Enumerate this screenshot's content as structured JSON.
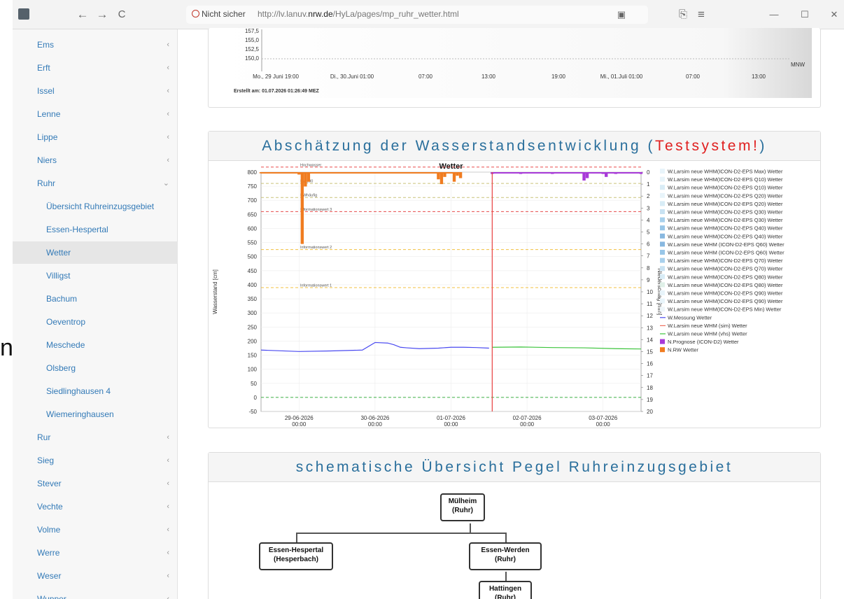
{
  "window": {
    "back": "←",
    "forward": "→",
    "reload": "C",
    "reader": "▣",
    "share": "⎘",
    "menu": "≡",
    "minimize": "—",
    "maximize": "☐",
    "close": "✕"
  },
  "address": {
    "insecure_label": "Nicht sicher",
    "url_prefix": "http://lv.lanuv.",
    "url_domain": "nrw.de",
    "url_suffix": "/HyLa/pages/mp_ruhr_wetter.html"
  },
  "bg_glyph": "n",
  "sidebar": {
    "items": [
      {
        "label": "Ems",
        "chevron": "‹"
      },
      {
        "label": "Erft",
        "chevron": "‹"
      },
      {
        "label": "Issel",
        "chevron": "‹"
      },
      {
        "label": "Lenne",
        "chevron": "‹"
      },
      {
        "label": "Lippe",
        "chevron": "‹"
      },
      {
        "label": "Niers",
        "chevron": "‹"
      },
      {
        "label": "Ruhr",
        "chevron": "⌄"
      },
      {
        "label": "Übersicht Ruhreinzugsgebiet"
      },
      {
        "label": "Essen-Hespertal"
      },
      {
        "label": "Wetter"
      },
      {
        "label": "Villigst"
      },
      {
        "label": "Bachum"
      },
      {
        "label": "Oeventrop"
      },
      {
        "label": "Meschede"
      },
      {
        "label": "Olsberg"
      },
      {
        "label": "Siedlinghausen 4"
      },
      {
        "label": "Wiemeringhausen"
      },
      {
        "label": "Rur",
        "chevron": "‹"
      },
      {
        "label": "Sieg",
        "chevron": "‹"
      },
      {
        "label": "Stever",
        "chevron": "‹"
      },
      {
        "label": "Vechte",
        "chevron": "‹"
      },
      {
        "label": "Volme",
        "chevron": "‹"
      },
      {
        "label": "Werre",
        "chevron": "‹"
      },
      {
        "label": "Weser",
        "chevron": "‹"
      },
      {
        "label": "Wupper",
        "chevron": "‹"
      }
    ]
  },
  "top_chart": {
    "y_ticks": [
      "157,5",
      "155,0",
      "152,5",
      "150,0"
    ],
    "x_ticks": [
      "Mo., 29 Juni 19:00",
      "Di., 30.Juni 01:00",
      "07:00",
      "13:00",
      "19:00",
      "Mi., 01.Juli 01:00",
      "07:00",
      "13:00"
    ],
    "mnw_label": "MNW",
    "created": "Erstellt am: 01.07.2026 01:26:49 MEZ"
  },
  "panel1": {
    "title_prefix": "Abschätzung der Wasserstandsentwicklung (",
    "title_red": "Testsystem!",
    "title_suffix": ")"
  },
  "chart_data": {
    "type": "line",
    "title": "Wetter",
    "ylabel": "Wasserstand [cm]",
    "y2label": "Niederschlag [mm]",
    "ylim": [
      -50,
      800
    ],
    "y2lim": [
      0,
      20
    ],
    "y_ticks": [
      800,
      750,
      700,
      650,
      600,
      550,
      500,
      450,
      400,
      350,
      300,
      250,
      200,
      150,
      100,
      50,
      0,
      -50
    ],
    "y2_ticks": [
      0,
      1,
      2,
      3,
      4,
      5,
      6,
      7,
      8,
      9,
      10,
      11,
      12,
      13,
      14,
      15,
      16,
      17,
      18,
      19,
      20
    ],
    "x_ticks": [
      "29-06-2026\n00:00",
      "30-06-2026\n00:00",
      "01-07-2026\n00:00",
      "02-07-2026\n00:00",
      "03-07-2026\n00:00"
    ],
    "x_range_hours": [
      -12,
      108
    ],
    "now_marker_hour": 61,
    "thresholds": [
      {
        "label": "Hochwasser",
        "value": 818,
        "color": "#e84c4c"
      },
      {
        "label": "HW100",
        "value": 760,
        "color": "#c9c27a"
      },
      {
        "label": "HWhäufig",
        "value": 710,
        "color": "#c9c27a"
      },
      {
        "label": "Informationswert 3",
        "value": 660,
        "color": "#e84c4c"
      },
      {
        "label": "Informationswert 2",
        "value": 525,
        "color": "#f0c040"
      },
      {
        "label": "Informationswert 1",
        "value": 390,
        "color": "#f0c040"
      },
      {
        "label": "",
        "value": 0,
        "color": "#3cb043"
      }
    ],
    "series": [
      {
        "name": "W.Messung Wetter",
        "color": "#4a4af0",
        "x": [
          -12,
          0,
          10,
          20,
          24,
          28,
          30,
          32,
          34,
          38,
          44,
          48,
          52,
          56,
          60
        ],
        "y": [
          168,
          163,
          165,
          168,
          195,
          193,
          187,
          178,
          176,
          173,
          175,
          178,
          178,
          177,
          175
        ]
      },
      {
        "name": "W.Larsim neue WHM (vhs) Wetter",
        "color": "#3cc43c",
        "x": [
          61,
          70,
          80,
          90,
          100,
          108
        ],
        "y": [
          178,
          179,
          177,
          176,
          173,
          172
        ]
      },
      {
        "name": "N.RW Wetter",
        "color": "#f07c20",
        "type": "bar",
        "x": [
          -12,
          0,
          1,
          2,
          3,
          44,
          45,
          46,
          49,
          50,
          51
        ],
        "y": [
          0.1,
          0.2,
          6,
          1.2,
          0.8,
          0.6,
          1.0,
          0.4,
          0.8,
          0.3,
          0.5
        ]
      },
      {
        "name": "N.Prognose (ICON-D2) Wetter",
        "color": "#a83ad8",
        "type": "bar",
        "x": [
          61,
          70,
          80,
          90,
          91,
          96,
          97,
          100,
          108
        ],
        "y": [
          0.15,
          0.15,
          0.15,
          0.7,
          0.5,
          0.15,
          0.4,
          0.15,
          0.15
        ]
      }
    ],
    "legend": [
      {
        "name": "W.Larsim neue WHM(ICON-D2-EPS Max) Wetter",
        "color": "#e8f4fa",
        "kind": "area"
      },
      {
        "name": "W.Larsim neue WHM(ICON-D2-EPS Q10) Wetter",
        "color": "#e8f4fa",
        "kind": "area"
      },
      {
        "name": "W.Larsim neue WHM(ICON-D2-EPS Q10) Wetter",
        "color": "#d8ecf6",
        "kind": "area"
      },
      {
        "name": "W.Larsim neue WHM(ICON-D2-EPS Q20) Wetter",
        "color": "#e8f4fa",
        "kind": "area"
      },
      {
        "name": "W.Larsim neue WHM(ICON-D2-EPS Q20) Wetter",
        "color": "#d8ecf6",
        "kind": "area"
      },
      {
        "name": "W.Larsim neue WHM(ICON-D2-EPS Q30) Wetter",
        "color": "#c8e2f2",
        "kind": "area"
      },
      {
        "name": "W.Larsim neue WHM(ICON-D2-EPS Q30) Wetter",
        "color": "#a8d0ec",
        "kind": "area"
      },
      {
        "name": "W.Larsim neue WHM(ICON-D2-EPS Q40) Wetter",
        "color": "#98c6e8",
        "kind": "area"
      },
      {
        "name": "W.Larsim neue WHM(ICON-D2-EPS Q40) Wetter",
        "color": "#88b8e0",
        "kind": "area"
      },
      {
        "name": "W.Larsim neue WHM (ICON-D2-EPS Q60) Wetter",
        "color": "#88b8e0",
        "kind": "area"
      },
      {
        "name": "W.Larsim neue WHM (ICON-D2-EPS Q60) Wetter",
        "color": "#98c6e8",
        "kind": "area"
      },
      {
        "name": "W.Larsim neue WHM(ICON-D2-EPS Q70) Wetter",
        "color": "#a8d0ec",
        "kind": "area"
      },
      {
        "name": "W.Larsim neue WHM(ICON-D2-EPS Q70) Wetter",
        "color": "#c8e2f2",
        "kind": "area"
      },
      {
        "name": "W.Larsim neue WHM(ICON-D2-EPS Q80) Wetter",
        "color": "#d8ecf6",
        "kind": "area"
      },
      {
        "name": "W.Larsim neue WHM(ICON-D2-EPS Q80) Wetter",
        "color": "#e0f0e8",
        "kind": "area"
      },
      {
        "name": "W.Larsim neue WHM(ICON-D2-EPS Q90) Wetter",
        "color": "#e8f4fa",
        "kind": "area"
      },
      {
        "name": "W.Larsim neue WHM(ICON-D2-EPS Q90) Wetter",
        "color": "#e8f4fa",
        "kind": "area"
      },
      {
        "name": "W.Larsim neue WHM(ICON-D2-EPS Min) Wetter",
        "color": "#eef6fa",
        "kind": "area"
      },
      {
        "name": "W.Messung Wetter",
        "color": "#4a4af0",
        "kind": "line"
      },
      {
        "name": "W.Larsim neue WHM (sim) Wetter",
        "color": "#f07060",
        "kind": "line"
      },
      {
        "name": "W.Larsim neue WHM (vhs) Wetter",
        "color": "#3cc43c",
        "kind": "line"
      },
      {
        "name": "N.Prognose (ICON-D2) Wetter",
        "color": "#a83ad8",
        "kind": "bar"
      },
      {
        "name": "N.RW Wetter",
        "color": "#f07c20",
        "kind": "bar"
      }
    ]
  },
  "panel2": {
    "title": "schematische Übersicht Pegel Ruhreinzugsgebiet"
  },
  "schema": {
    "muelheim": "Mülheim\n(Ruhr)",
    "hespertal": "Essen-Hespertal\n(Hesperbach)",
    "werden": "Essen-Werden\n(Ruhr)",
    "hattingen": "Hattingen\n(Ruhr)"
  }
}
